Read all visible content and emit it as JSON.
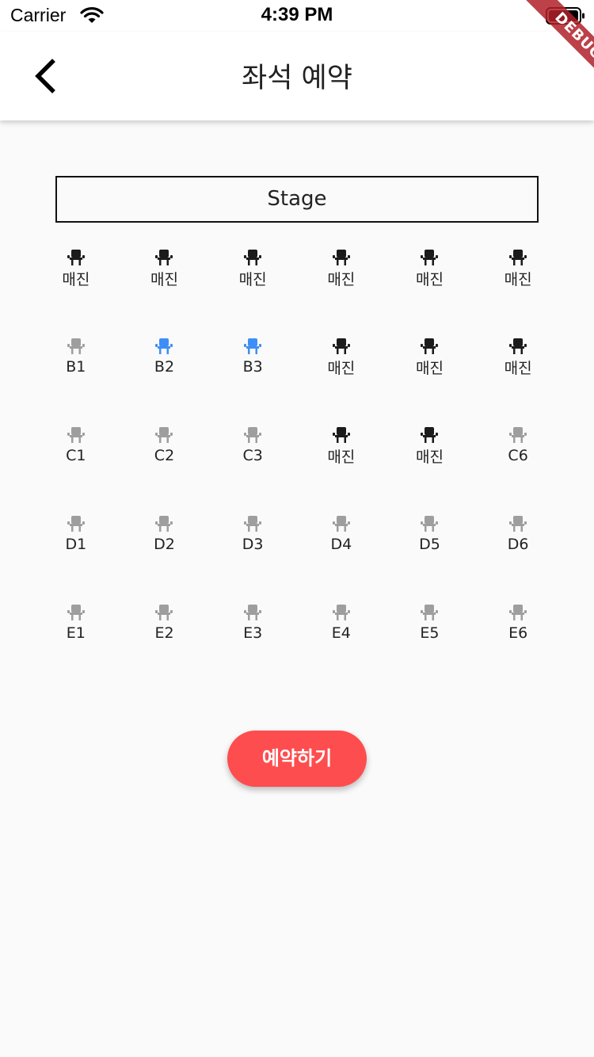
{
  "status_bar": {
    "carrier": "Carrier",
    "time": "4:39 PM"
  },
  "app_bar": {
    "title": "좌석 예약",
    "back_icon": "chevron-left-icon"
  },
  "debug_banner": "DEBUG",
  "stage_label": "Stage",
  "colors": {
    "available": "#9e9e9e",
    "selected": "#3f8ef7",
    "sold": "#1b1b1b",
    "accent": "#fe4d4f"
  },
  "seats": {
    "rows": [
      {
        "row": "A",
        "seats": [
          {
            "label": "매진",
            "state": "sold"
          },
          {
            "label": "매진",
            "state": "sold"
          },
          {
            "label": "매진",
            "state": "sold"
          },
          {
            "label": "매진",
            "state": "sold"
          },
          {
            "label": "매진",
            "state": "sold"
          },
          {
            "label": "매진",
            "state": "sold"
          }
        ]
      },
      {
        "row": "B",
        "seats": [
          {
            "label": "B1",
            "state": "available"
          },
          {
            "label": "B2",
            "state": "selected"
          },
          {
            "label": "B3",
            "state": "selected"
          },
          {
            "label": "매진",
            "state": "sold"
          },
          {
            "label": "매진",
            "state": "sold"
          },
          {
            "label": "매진",
            "state": "sold"
          }
        ]
      },
      {
        "row": "C",
        "seats": [
          {
            "label": "C1",
            "state": "available"
          },
          {
            "label": "C2",
            "state": "available"
          },
          {
            "label": "C3",
            "state": "available"
          },
          {
            "label": "매진",
            "state": "sold"
          },
          {
            "label": "매진",
            "state": "sold"
          },
          {
            "label": "C6",
            "state": "available"
          }
        ]
      },
      {
        "row": "D",
        "seats": [
          {
            "label": "D1",
            "state": "available"
          },
          {
            "label": "D2",
            "state": "available"
          },
          {
            "label": "D3",
            "state": "available"
          },
          {
            "label": "D4",
            "state": "available"
          },
          {
            "label": "D5",
            "state": "available"
          },
          {
            "label": "D6",
            "state": "available"
          }
        ]
      },
      {
        "row": "E",
        "seats": [
          {
            "label": "E1",
            "state": "available"
          },
          {
            "label": "E2",
            "state": "available"
          },
          {
            "label": "E3",
            "state": "available"
          },
          {
            "label": "E4",
            "state": "available"
          },
          {
            "label": "E5",
            "state": "available"
          },
          {
            "label": "E6",
            "state": "available"
          }
        ]
      }
    ]
  },
  "reserve_button": "예약하기"
}
